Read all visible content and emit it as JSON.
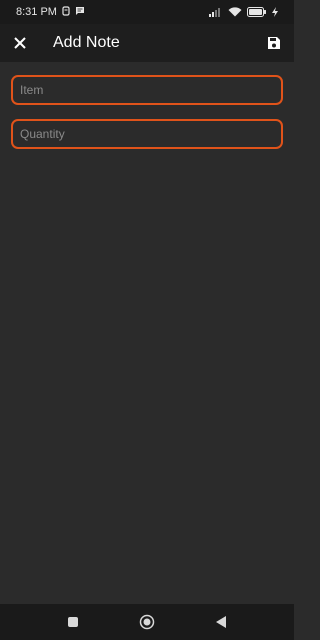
{
  "status_bar": {
    "time": "8:31 PM"
  },
  "app_bar": {
    "title": "Add Note",
    "close_icon": "close-icon",
    "save_icon": "save-icon"
  },
  "form": {
    "item_placeholder": "Item",
    "item_value": "",
    "quantity_placeholder": "Quantity",
    "quantity_value": ""
  },
  "colors": {
    "accent": "#e0531a",
    "background": "#2b2b2b",
    "app_bar": "#1e1e1e",
    "status_bar": "#1a1a1a"
  },
  "nav_bar": {
    "icons": [
      "recents-square-icon",
      "home-circle-icon",
      "back-triangle-icon"
    ]
  }
}
